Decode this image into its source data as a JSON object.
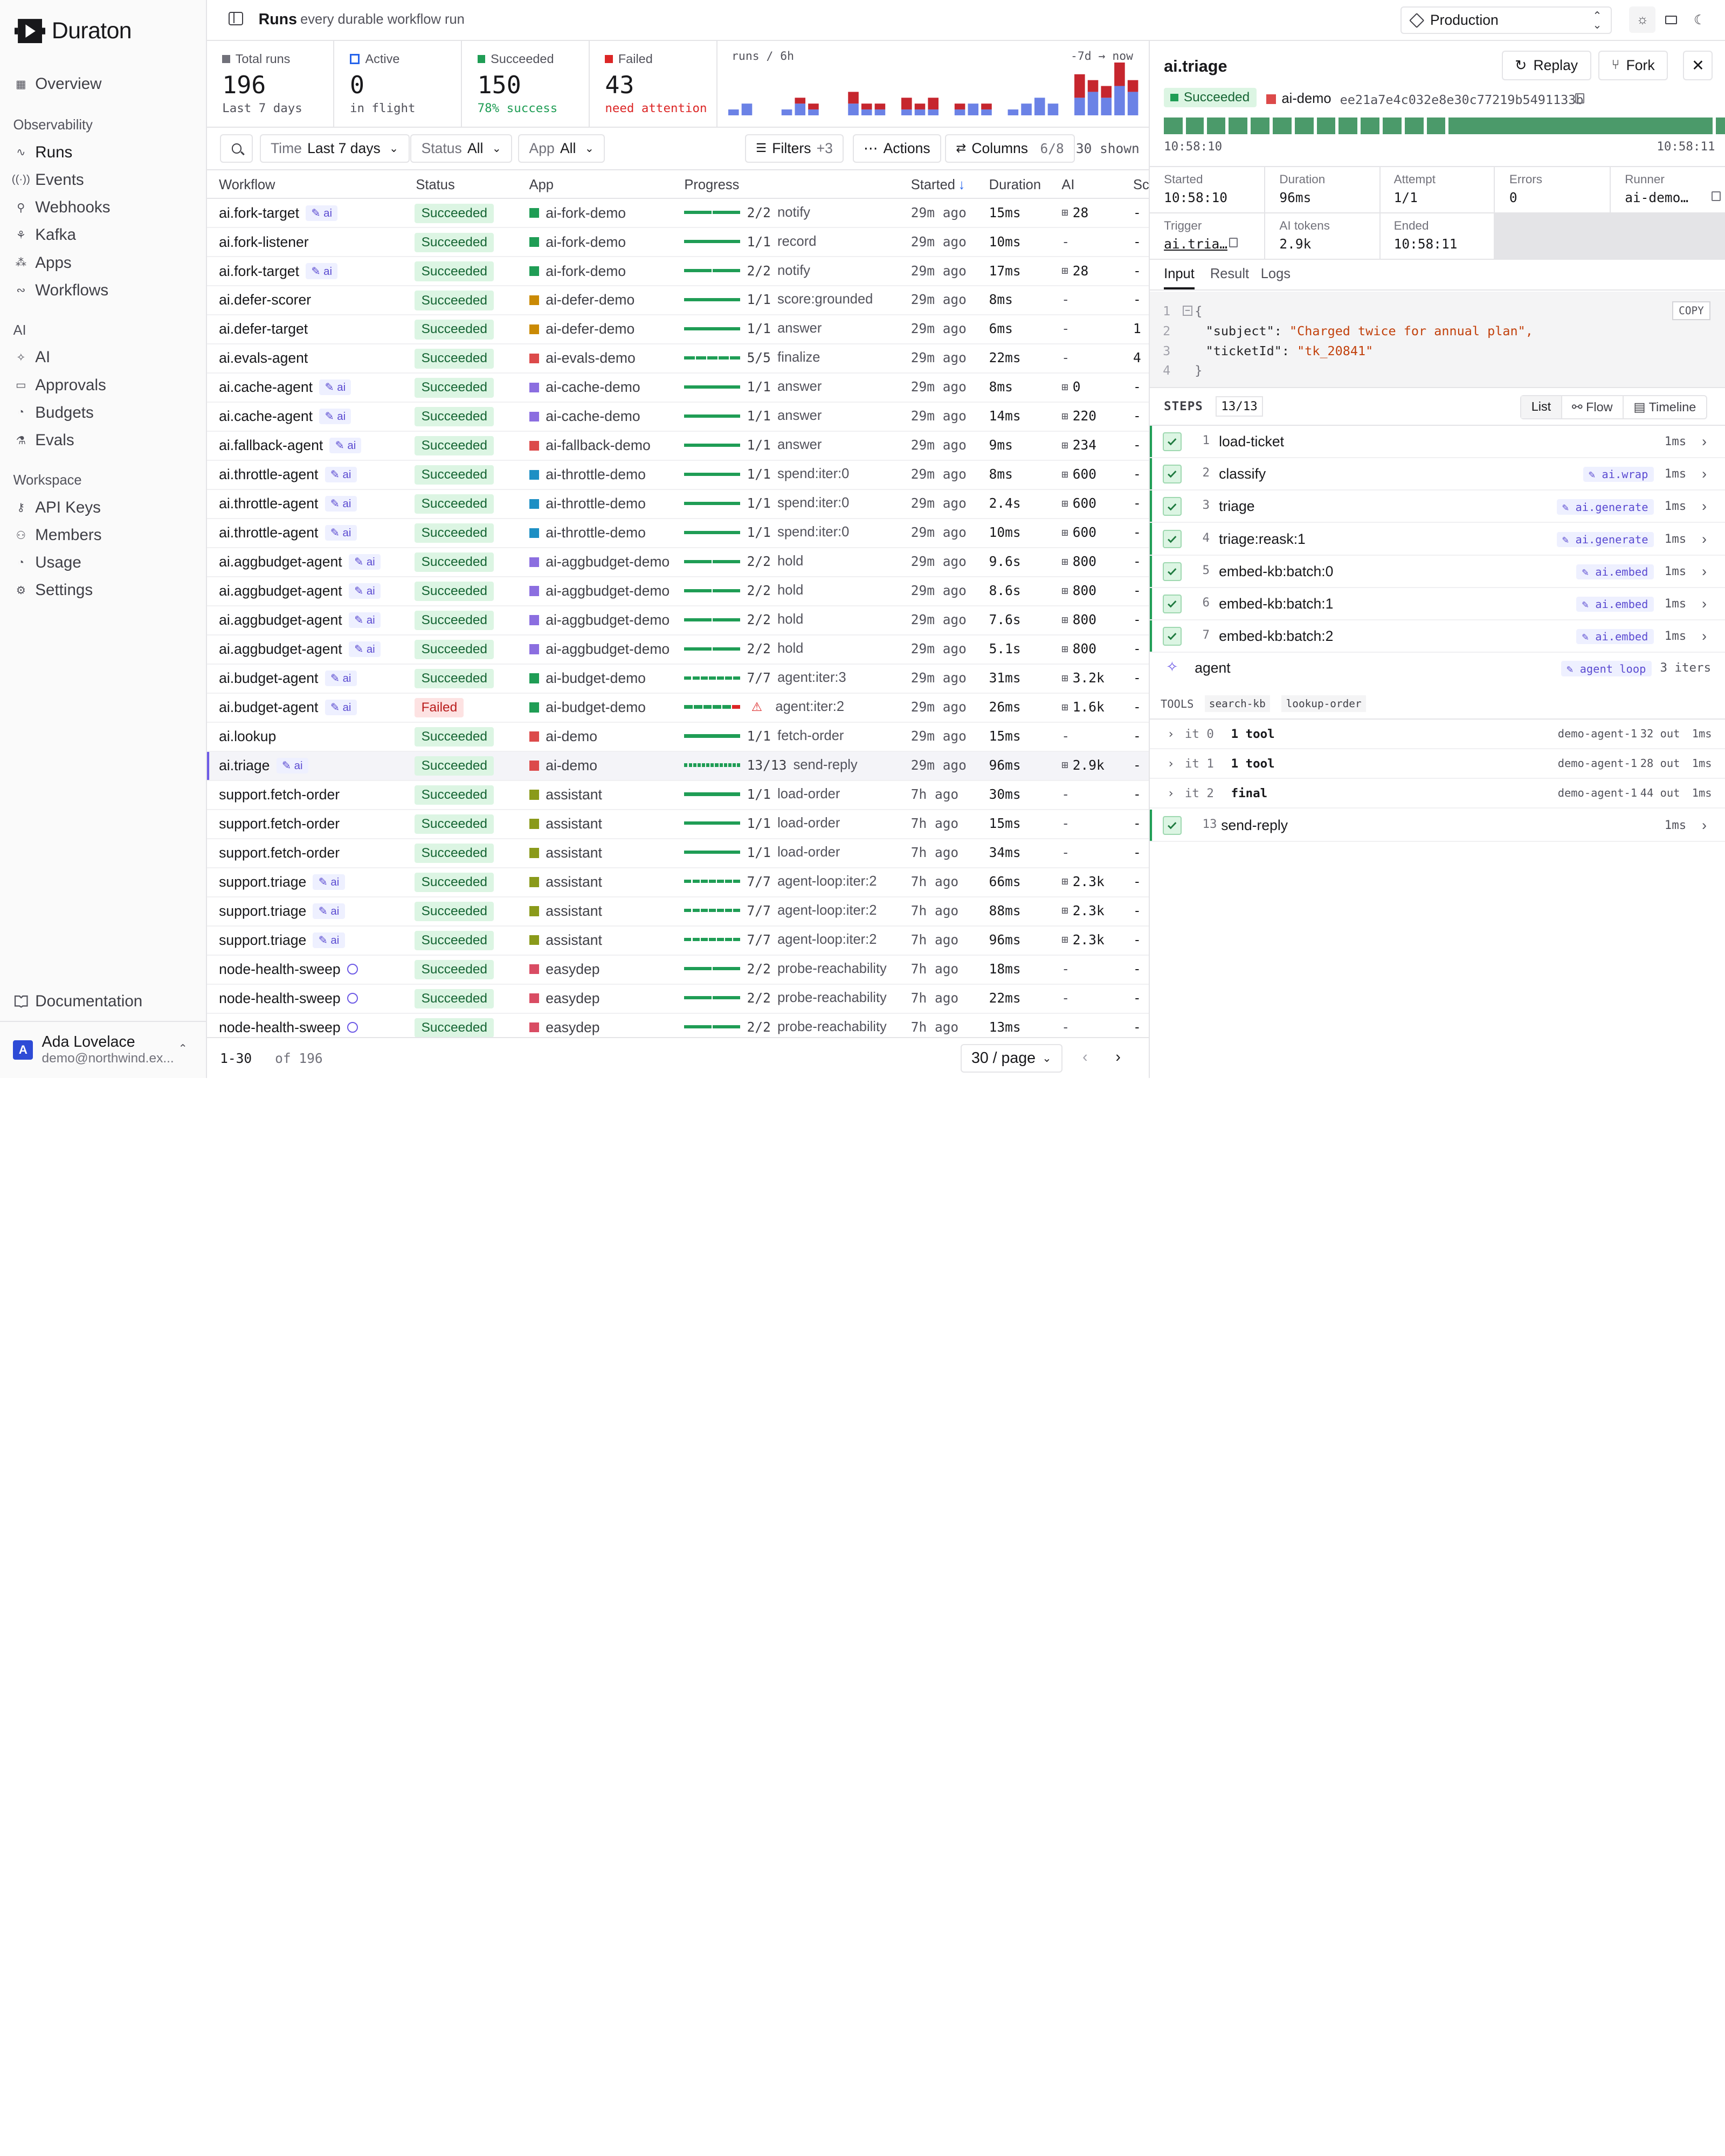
{
  "brand": {
    "name": "Duraton"
  },
  "sidebar": {
    "top": [
      {
        "label": "Overview",
        "icon": "grid-icon"
      }
    ],
    "sections": [
      {
        "title": "Observability",
        "items": [
          {
            "label": "Runs",
            "icon": "runs-icon",
            "active": true
          },
          {
            "label": "Events",
            "icon": "radio-icon"
          },
          {
            "label": "Webhooks",
            "icon": "webhook-icon"
          },
          {
            "label": "Kafka",
            "icon": "kafka-icon"
          },
          {
            "label": "Apps",
            "icon": "apps-icon"
          },
          {
            "label": "Workflows",
            "icon": "workflow-icon"
          }
        ]
      },
      {
        "title": "AI",
        "items": [
          {
            "label": "AI",
            "icon": "sparkle-icon"
          },
          {
            "label": "Approvals",
            "icon": "inbox-icon"
          },
          {
            "label": "Budgets",
            "icon": "gauge-icon"
          },
          {
            "label": "Evals",
            "icon": "flask-icon"
          }
        ]
      },
      {
        "title": "Workspace",
        "items": [
          {
            "label": "API Keys",
            "icon": "key-icon"
          },
          {
            "label": "Members",
            "icon": "users-icon"
          },
          {
            "label": "Usage",
            "icon": "gauge-icon"
          },
          {
            "label": "Settings",
            "icon": "gear-icon"
          }
        ]
      }
    ],
    "documentation": "Documentation",
    "user": {
      "initial": "A",
      "name": "Ada Lovelace",
      "email": "demo@northwind.ex..."
    }
  },
  "header": {
    "title": "Runs",
    "subtitle": "every durable workflow run",
    "environment": "Production"
  },
  "stats": [
    {
      "label": "Total runs",
      "value": "196",
      "sub": "Last 7 days",
      "color": "#71717a"
    },
    {
      "label": "Active",
      "value": "0",
      "sub": "in flight",
      "color": "#2563eb"
    },
    {
      "label": "Succeeded",
      "value": "150",
      "sub": "78% success",
      "color": "#1f9d55"
    },
    {
      "label": "Failed",
      "value": "43",
      "sub": "need attention",
      "color": "#dc2626"
    }
  ],
  "chart_data": {
    "type": "bar",
    "title": "runs / 6h",
    "range_label": "-7d → now",
    "series": [
      {
        "name": "succeeded",
        "color": "#6b82e6",
        "values": [
          0,
          0,
          0,
          0,
          0,
          0,
          0,
          0,
          0,
          0,
          0,
          0,
          0,
          0,
          0,
          0,
          0,
          0,
          0,
          0,
          0,
          0,
          0,
          0,
          0,
          0,
          0,
          0
        ]
      },
      {
        "name": "failed",
        "color": "#c6262e",
        "values": [
          0,
          0,
          0,
          0,
          0,
          0,
          0,
          0,
          0,
          0,
          0,
          0,
          0,
          0,
          0,
          0,
          0,
          0,
          0,
          0,
          0,
          0,
          0,
          0,
          0,
          0,
          0,
          0
        ]
      }
    ],
    "bars": [
      [
        1,
        0
      ],
      [
        2,
        0
      ],
      [
        0,
        0
      ],
      [
        0,
        0
      ],
      [
        1,
        0
      ],
      [
        2,
        1
      ],
      [
        1,
        1
      ],
      [
        0,
        0
      ],
      [
        0,
        0
      ],
      [
        2,
        2
      ],
      [
        1,
        1
      ],
      [
        1,
        1
      ],
      [
        0,
        0
      ],
      [
        1,
        2
      ],
      [
        1,
        1
      ],
      [
        1,
        2
      ],
      [
        0,
        0
      ],
      [
        1,
        1
      ],
      [
        2,
        0
      ],
      [
        1,
        1
      ],
      [
        0,
        0
      ],
      [
        1,
        0
      ],
      [
        2,
        0
      ],
      [
        3,
        0
      ],
      [
        2,
        0
      ],
      [
        0,
        0
      ],
      [
        3,
        4
      ],
      [
        4,
        2
      ],
      [
        3,
        2
      ],
      [
        5,
        4
      ],
      [
        4,
        2
      ]
    ]
  },
  "toolbar": {
    "time_key": "Time",
    "time_val": "Last 7 days",
    "status_key": "Status",
    "status_val": "All",
    "app_key": "App",
    "app_val": "All",
    "filters": "Filters",
    "filters_count": "+3",
    "actions": "Actions",
    "columns": "Columns",
    "columns_count": "6/8",
    "shown": "30 shown"
  },
  "table": {
    "headers": [
      "Workflow",
      "Status",
      "App",
      "Progress",
      "Started",
      "Duration",
      "AI",
      "Sc"
    ],
    "rows": [
      {
        "wf": "ai.fork-target",
        "ai": true,
        "status": "Succeeded",
        "app": "ai-fork-demo",
        "appColor": "#1f9d55",
        "segs": 2,
        "fail": 0,
        "count": "2/2",
        "step": "notify",
        "started": "29m ago",
        "dur": "15ms",
        "tokens": "28",
        "sc": "-"
      },
      {
        "wf": "ai.fork-listener",
        "ai": false,
        "status": "Succeeded",
        "app": "ai-fork-demo",
        "appColor": "#1f9d55",
        "segs": 1,
        "fail": 0,
        "count": "1/1",
        "step": "record",
        "started": "29m ago",
        "dur": "10ms",
        "tokens": "",
        "sc": "-"
      },
      {
        "wf": "ai.fork-target",
        "ai": true,
        "status": "Succeeded",
        "app": "ai-fork-demo",
        "appColor": "#1f9d55",
        "segs": 2,
        "fail": 0,
        "count": "2/2",
        "step": "notify",
        "started": "29m ago",
        "dur": "17ms",
        "tokens": "28",
        "sc": "-"
      },
      {
        "wf": "ai.defer-scorer",
        "ai": false,
        "status": "Succeeded",
        "app": "ai-defer-demo",
        "appColor": "#ca8a04",
        "segs": 1,
        "fail": 0,
        "count": "1/1",
        "step": "score:grounded",
        "started": "29m ago",
        "dur": "8ms",
        "tokens": "",
        "sc": "-"
      },
      {
        "wf": "ai.defer-target",
        "ai": false,
        "status": "Succeeded",
        "app": "ai-defer-demo",
        "appColor": "#ca8a04",
        "segs": 1,
        "fail": 0,
        "count": "1/1",
        "step": "answer",
        "started": "29m ago",
        "dur": "6ms",
        "tokens": "",
        "sc": "1"
      },
      {
        "wf": "ai.evals-agent",
        "ai": false,
        "status": "Succeeded",
        "app": "ai-evals-demo",
        "appColor": "#dc4a4a",
        "segs": 5,
        "fail": 0,
        "count": "5/5",
        "step": "finalize",
        "started": "29m ago",
        "dur": "22ms",
        "tokens": "",
        "sc": "4"
      },
      {
        "wf": "ai.cache-agent",
        "ai": true,
        "status": "Succeeded",
        "app": "ai-cache-demo",
        "appColor": "#8b6ee0",
        "segs": 1,
        "fail": 0,
        "count": "1/1",
        "step": "answer",
        "started": "29m ago",
        "dur": "8ms",
        "tokens": "0",
        "sc": "-"
      },
      {
        "wf": "ai.cache-agent",
        "ai": true,
        "status": "Succeeded",
        "app": "ai-cache-demo",
        "appColor": "#8b6ee0",
        "segs": 1,
        "fail": 0,
        "count": "1/1",
        "step": "answer",
        "started": "29m ago",
        "dur": "14ms",
        "tokens": "220",
        "sc": "-"
      },
      {
        "wf": "ai.fallback-agent",
        "ai": true,
        "status": "Succeeded",
        "app": "ai-fallback-demo",
        "appColor": "#dc4a4a",
        "segs": 1,
        "fail": 0,
        "count": "1/1",
        "step": "answer",
        "started": "29m ago",
        "dur": "9ms",
        "tokens": "234",
        "sc": "-"
      },
      {
        "wf": "ai.throttle-agent",
        "ai": true,
        "status": "Succeeded",
        "app": "ai-throttle-demo",
        "appColor": "#1d8fc4",
        "segs": 1,
        "fail": 0,
        "count": "1/1",
        "step": "spend:iter:0",
        "started": "29m ago",
        "dur": "8ms",
        "tokens": "600",
        "sc": "-"
      },
      {
        "wf": "ai.throttle-agent",
        "ai": true,
        "status": "Succeeded",
        "app": "ai-throttle-demo",
        "appColor": "#1d8fc4",
        "segs": 1,
        "fail": 0,
        "count": "1/1",
        "step": "spend:iter:0",
        "started": "29m ago",
        "dur": "2.4s",
        "tokens": "600",
        "sc": "-"
      },
      {
        "wf": "ai.throttle-agent",
        "ai": true,
        "status": "Succeeded",
        "app": "ai-throttle-demo",
        "appColor": "#1d8fc4",
        "segs": 1,
        "fail": 0,
        "count": "1/1",
        "step": "spend:iter:0",
        "started": "29m ago",
        "dur": "10ms",
        "tokens": "600",
        "sc": "-"
      },
      {
        "wf": "ai.aggbudget-agent",
        "ai": true,
        "status": "Succeeded",
        "app": "ai-aggbudget-demo",
        "appColor": "#8b6ee0",
        "segs": 2,
        "fail": 0,
        "count": "2/2",
        "step": "hold",
        "started": "29m ago",
        "dur": "9.6s",
        "tokens": "800",
        "sc": "-"
      },
      {
        "wf": "ai.aggbudget-agent",
        "ai": true,
        "status": "Succeeded",
        "app": "ai-aggbudget-demo",
        "appColor": "#8b6ee0",
        "segs": 2,
        "fail": 0,
        "count": "2/2",
        "step": "hold",
        "started": "29m ago",
        "dur": "8.6s",
        "tokens": "800",
        "sc": "-"
      },
      {
        "wf": "ai.aggbudget-agent",
        "ai": true,
        "status": "Succeeded",
        "app": "ai-aggbudget-demo",
        "appColor": "#8b6ee0",
        "segs": 2,
        "fail": 0,
        "count": "2/2",
        "step": "hold",
        "started": "29m ago",
        "dur": "7.6s",
        "tokens": "800",
        "sc": "-"
      },
      {
        "wf": "ai.aggbudget-agent",
        "ai": true,
        "status": "Succeeded",
        "app": "ai-aggbudget-demo",
        "appColor": "#8b6ee0",
        "segs": 2,
        "fail": 0,
        "count": "2/2",
        "step": "hold",
        "started": "29m ago",
        "dur": "5.1s",
        "tokens": "800",
        "sc": "-"
      },
      {
        "wf": "ai.budget-agent",
        "ai": true,
        "status": "Succeeded",
        "app": "ai-budget-demo",
        "appColor": "#1f9d55",
        "segs": 7,
        "fail": 0,
        "count": "7/7",
        "step": "agent:iter:3",
        "started": "29m ago",
        "dur": "31ms",
        "tokens": "3.2k",
        "sc": "-"
      },
      {
        "wf": "ai.budget-agent",
        "ai": true,
        "status": "Failed",
        "app": "ai-budget-demo",
        "appColor": "#1f9d55",
        "segs": 5,
        "fail": 1,
        "count": "",
        "step": "agent:iter:2",
        "started": "29m ago",
        "dur": "26ms",
        "tokens": "1.6k",
        "sc": "-"
      },
      {
        "wf": "ai.lookup",
        "ai": false,
        "status": "Succeeded",
        "app": "ai-demo",
        "appColor": "#dc4a4a",
        "segs": 1,
        "fail": 0,
        "count": "1/1",
        "step": "fetch-order",
        "started": "29m ago",
        "dur": "15ms",
        "tokens": "",
        "sc": "-"
      },
      {
        "wf": "ai.triage",
        "ai": true,
        "sel": true,
        "status": "Succeeded",
        "app": "ai-demo",
        "appColor": "#dc4a4a",
        "segs": 13,
        "fail": 0,
        "count": "13/13",
        "step": "send-reply",
        "started": "29m ago",
        "dur": "96ms",
        "tokens": "2.9k",
        "sc": "-"
      },
      {
        "wf": "support.fetch-order",
        "ai": false,
        "status": "Succeeded",
        "app": "assistant",
        "appColor": "#8a9a1a",
        "segs": 1,
        "fail": 0,
        "count": "1/1",
        "step": "load-order",
        "started": "7h ago",
        "dur": "30ms",
        "tokens": "",
        "sc": "-"
      },
      {
        "wf": "support.fetch-order",
        "ai": false,
        "status": "Succeeded",
        "app": "assistant",
        "appColor": "#8a9a1a",
        "segs": 1,
        "fail": 0,
        "count": "1/1",
        "step": "load-order",
        "started": "7h ago",
        "dur": "15ms",
        "tokens": "",
        "sc": "-"
      },
      {
        "wf": "support.fetch-order",
        "ai": false,
        "status": "Succeeded",
        "app": "assistant",
        "appColor": "#8a9a1a",
        "segs": 1,
        "fail": 0,
        "count": "1/1",
        "step": "load-order",
        "started": "7h ago",
        "dur": "34ms",
        "tokens": "",
        "sc": "-"
      },
      {
        "wf": "support.triage",
        "ai": true,
        "status": "Succeeded",
        "app": "assistant",
        "appColor": "#8a9a1a",
        "segs": 7,
        "fail": 0,
        "count": "7/7",
        "step": "agent-loop:iter:2",
        "started": "7h ago",
        "dur": "66ms",
        "tokens": "2.3k",
        "sc": "-"
      },
      {
        "wf": "support.triage",
        "ai": true,
        "status": "Succeeded",
        "app": "assistant",
        "appColor": "#8a9a1a",
        "segs": 7,
        "fail": 0,
        "count": "7/7",
        "step": "agent-loop:iter:2",
        "started": "7h ago",
        "dur": "88ms",
        "tokens": "2.3k",
        "sc": "-"
      },
      {
        "wf": "support.triage",
        "ai": true,
        "status": "Succeeded",
        "app": "assistant",
        "appColor": "#8a9a1a",
        "segs": 7,
        "fail": 0,
        "count": "7/7",
        "step": "agent-loop:iter:2",
        "started": "7h ago",
        "dur": "96ms",
        "tokens": "2.3k",
        "sc": "-"
      },
      {
        "wf": "node-health-sweep",
        "cron": true,
        "ai": false,
        "status": "Succeeded",
        "app": "easydep",
        "appColor": "#d94c63",
        "segs": 2,
        "fail": 0,
        "count": "2/2",
        "step": "probe-reachability",
        "started": "7h ago",
        "dur": "18ms",
        "tokens": "",
        "sc": "-"
      },
      {
        "wf": "node-health-sweep",
        "cron": true,
        "ai": false,
        "status": "Succeeded",
        "app": "easydep",
        "appColor": "#d94c63",
        "segs": 2,
        "fail": 0,
        "count": "2/2",
        "step": "probe-reachability",
        "started": "7h ago",
        "dur": "22ms",
        "tokens": "",
        "sc": "-"
      },
      {
        "wf": "node-health-sweep",
        "cron": true,
        "ai": false,
        "status": "Succeeded",
        "app": "easydep",
        "appColor": "#d94c63",
        "segs": 2,
        "fail": 0,
        "count": "2/2",
        "step": "probe-reachability",
        "started": "7h ago",
        "dur": "13ms",
        "tokens": "",
        "sc": "-"
      }
    ]
  },
  "footer": {
    "range": "1-30",
    "of": "of 196",
    "page_size": "30 / page"
  },
  "detail": {
    "title": "ai.triage",
    "replay": "Replay",
    "fork": "Fork",
    "status": "Succeeded",
    "app": "ai-demo",
    "run_id": "ee21a7e4c032e8e30c77219b5491133b",
    "timeline_start": "10:58:10",
    "timeline_end": "10:58:11",
    "meta": [
      {
        "label": "Started",
        "value": "10:58:10"
      },
      {
        "label": "Duration",
        "value": "96ms"
      },
      {
        "label": "Attempt",
        "value": "1/1"
      },
      {
        "label": "Errors",
        "value": "0"
      },
      {
        "label": "Runner",
        "value": "ai-demo…"
      },
      {
        "label": "Trigger",
        "value": "ai.tria…"
      },
      {
        "label": "AI tokens",
        "value": "2.9k"
      },
      {
        "label": "Ended",
        "value": "10:58:11"
      }
    ],
    "tabs": [
      "Input",
      "Result",
      "Logs"
    ],
    "copy": "COPY",
    "code": [
      {
        "n": "1",
        "text": "{"
      },
      {
        "n": "2",
        "key": "\"subject\"",
        "val": "\"Charged twice for annual plan\","
      },
      {
        "n": "3",
        "key": "\"ticketId\"",
        "val": "\"tk_20841\""
      },
      {
        "n": "4",
        "text": "}"
      }
    ],
    "steps_label": "STEPS",
    "steps_count": "13/13",
    "views": [
      "List",
      "Flow",
      "Timeline"
    ],
    "steps": [
      {
        "n": "1",
        "name": "load-ticket",
        "tag": "",
        "ms": "1ms"
      },
      {
        "n": "2",
        "name": "classify",
        "tag": "ai.wrap",
        "ms": "1ms"
      },
      {
        "n": "3",
        "name": "triage",
        "tag": "ai.generate",
        "ms": "1ms"
      },
      {
        "n": "4",
        "name": "triage:reask:1",
        "tag": "ai.generate",
        "ms": "1ms"
      },
      {
        "n": "5",
        "name": "embed-kb:batch:0",
        "tag": "ai.embed",
        "ms": "1ms"
      },
      {
        "n": "6",
        "name": "embed-kb:batch:1",
        "tag": "ai.embed",
        "ms": "1ms"
      },
      {
        "n": "7",
        "name": "embed-kb:batch:2",
        "tag": "ai.embed",
        "ms": "1ms"
      }
    ],
    "agent": {
      "name": "agent",
      "tag": "agent loop",
      "iters": "3 iters"
    },
    "tools_label": "TOOLS",
    "tools": [
      "search-kb",
      "lookup-order"
    ],
    "iterations": [
      {
        "it": "it 0",
        "label": "1 tool",
        "runner": "demo-agent-1",
        "out": "32 out",
        "ms": "1ms"
      },
      {
        "it": "it 1",
        "label": "1 tool",
        "runner": "demo-agent-1",
        "out": "28 out",
        "ms": "1ms"
      },
      {
        "it": "it 2",
        "label": "final",
        "runner": "demo-agent-1",
        "out": "44 out",
        "ms": "1ms"
      }
    ],
    "last_step": {
      "n": "13",
      "name": "send-reply",
      "ms": "1ms"
    }
  }
}
